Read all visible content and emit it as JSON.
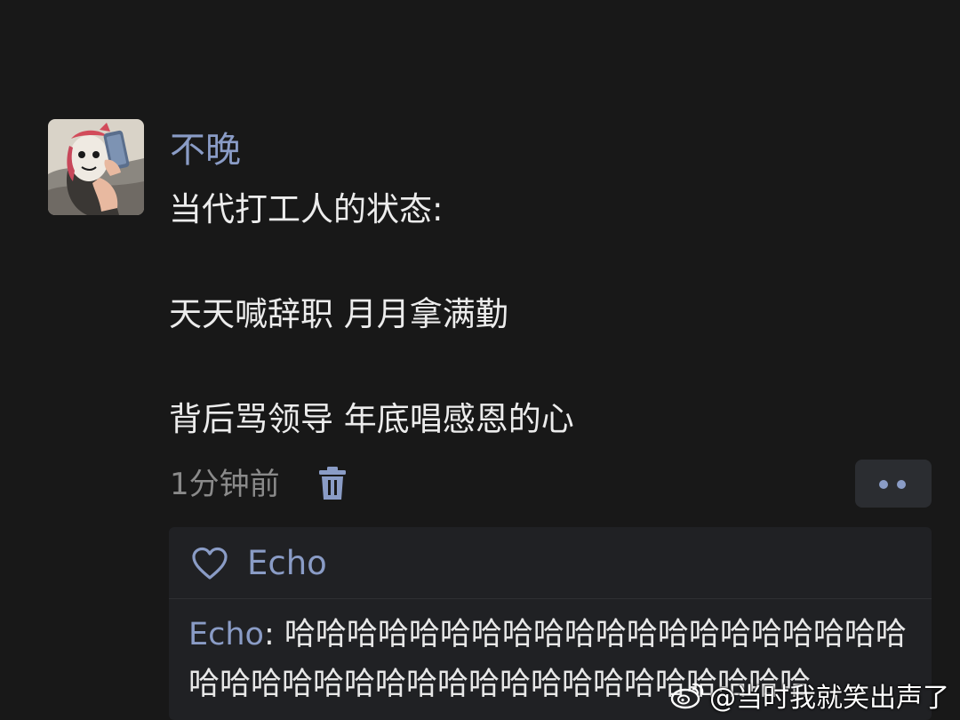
{
  "post": {
    "username": "不晚",
    "lines": [
      "当代打工人的状态:",
      "",
      "天天喊辞职 月月拿满勤",
      "",
      "背后骂领导 年底唱感恩的心"
    ],
    "timestamp": "1分钟前"
  },
  "icons": {
    "delete": "trash-icon",
    "more": "more-dots-icon",
    "like": "heart-outline-icon",
    "watermark": "weibo-logo-icon"
  },
  "interactions": {
    "likes": [
      "Echo"
    ],
    "comments": [
      {
        "author": "Echo",
        "separator": ": ",
        "text": "哈哈哈哈哈哈哈哈哈哈哈哈哈哈哈哈哈哈哈哈哈哈哈哈哈哈哈哈哈哈哈哈哈哈哈哈哈哈哈哈"
      }
    ]
  },
  "watermark": {
    "text": "@当时我就笑出声了"
  },
  "colors": {
    "background": "#181818",
    "accent": "#8a9cc6",
    "text": "#ececec",
    "muted": "#8a8a8a",
    "panel": "#202124"
  }
}
